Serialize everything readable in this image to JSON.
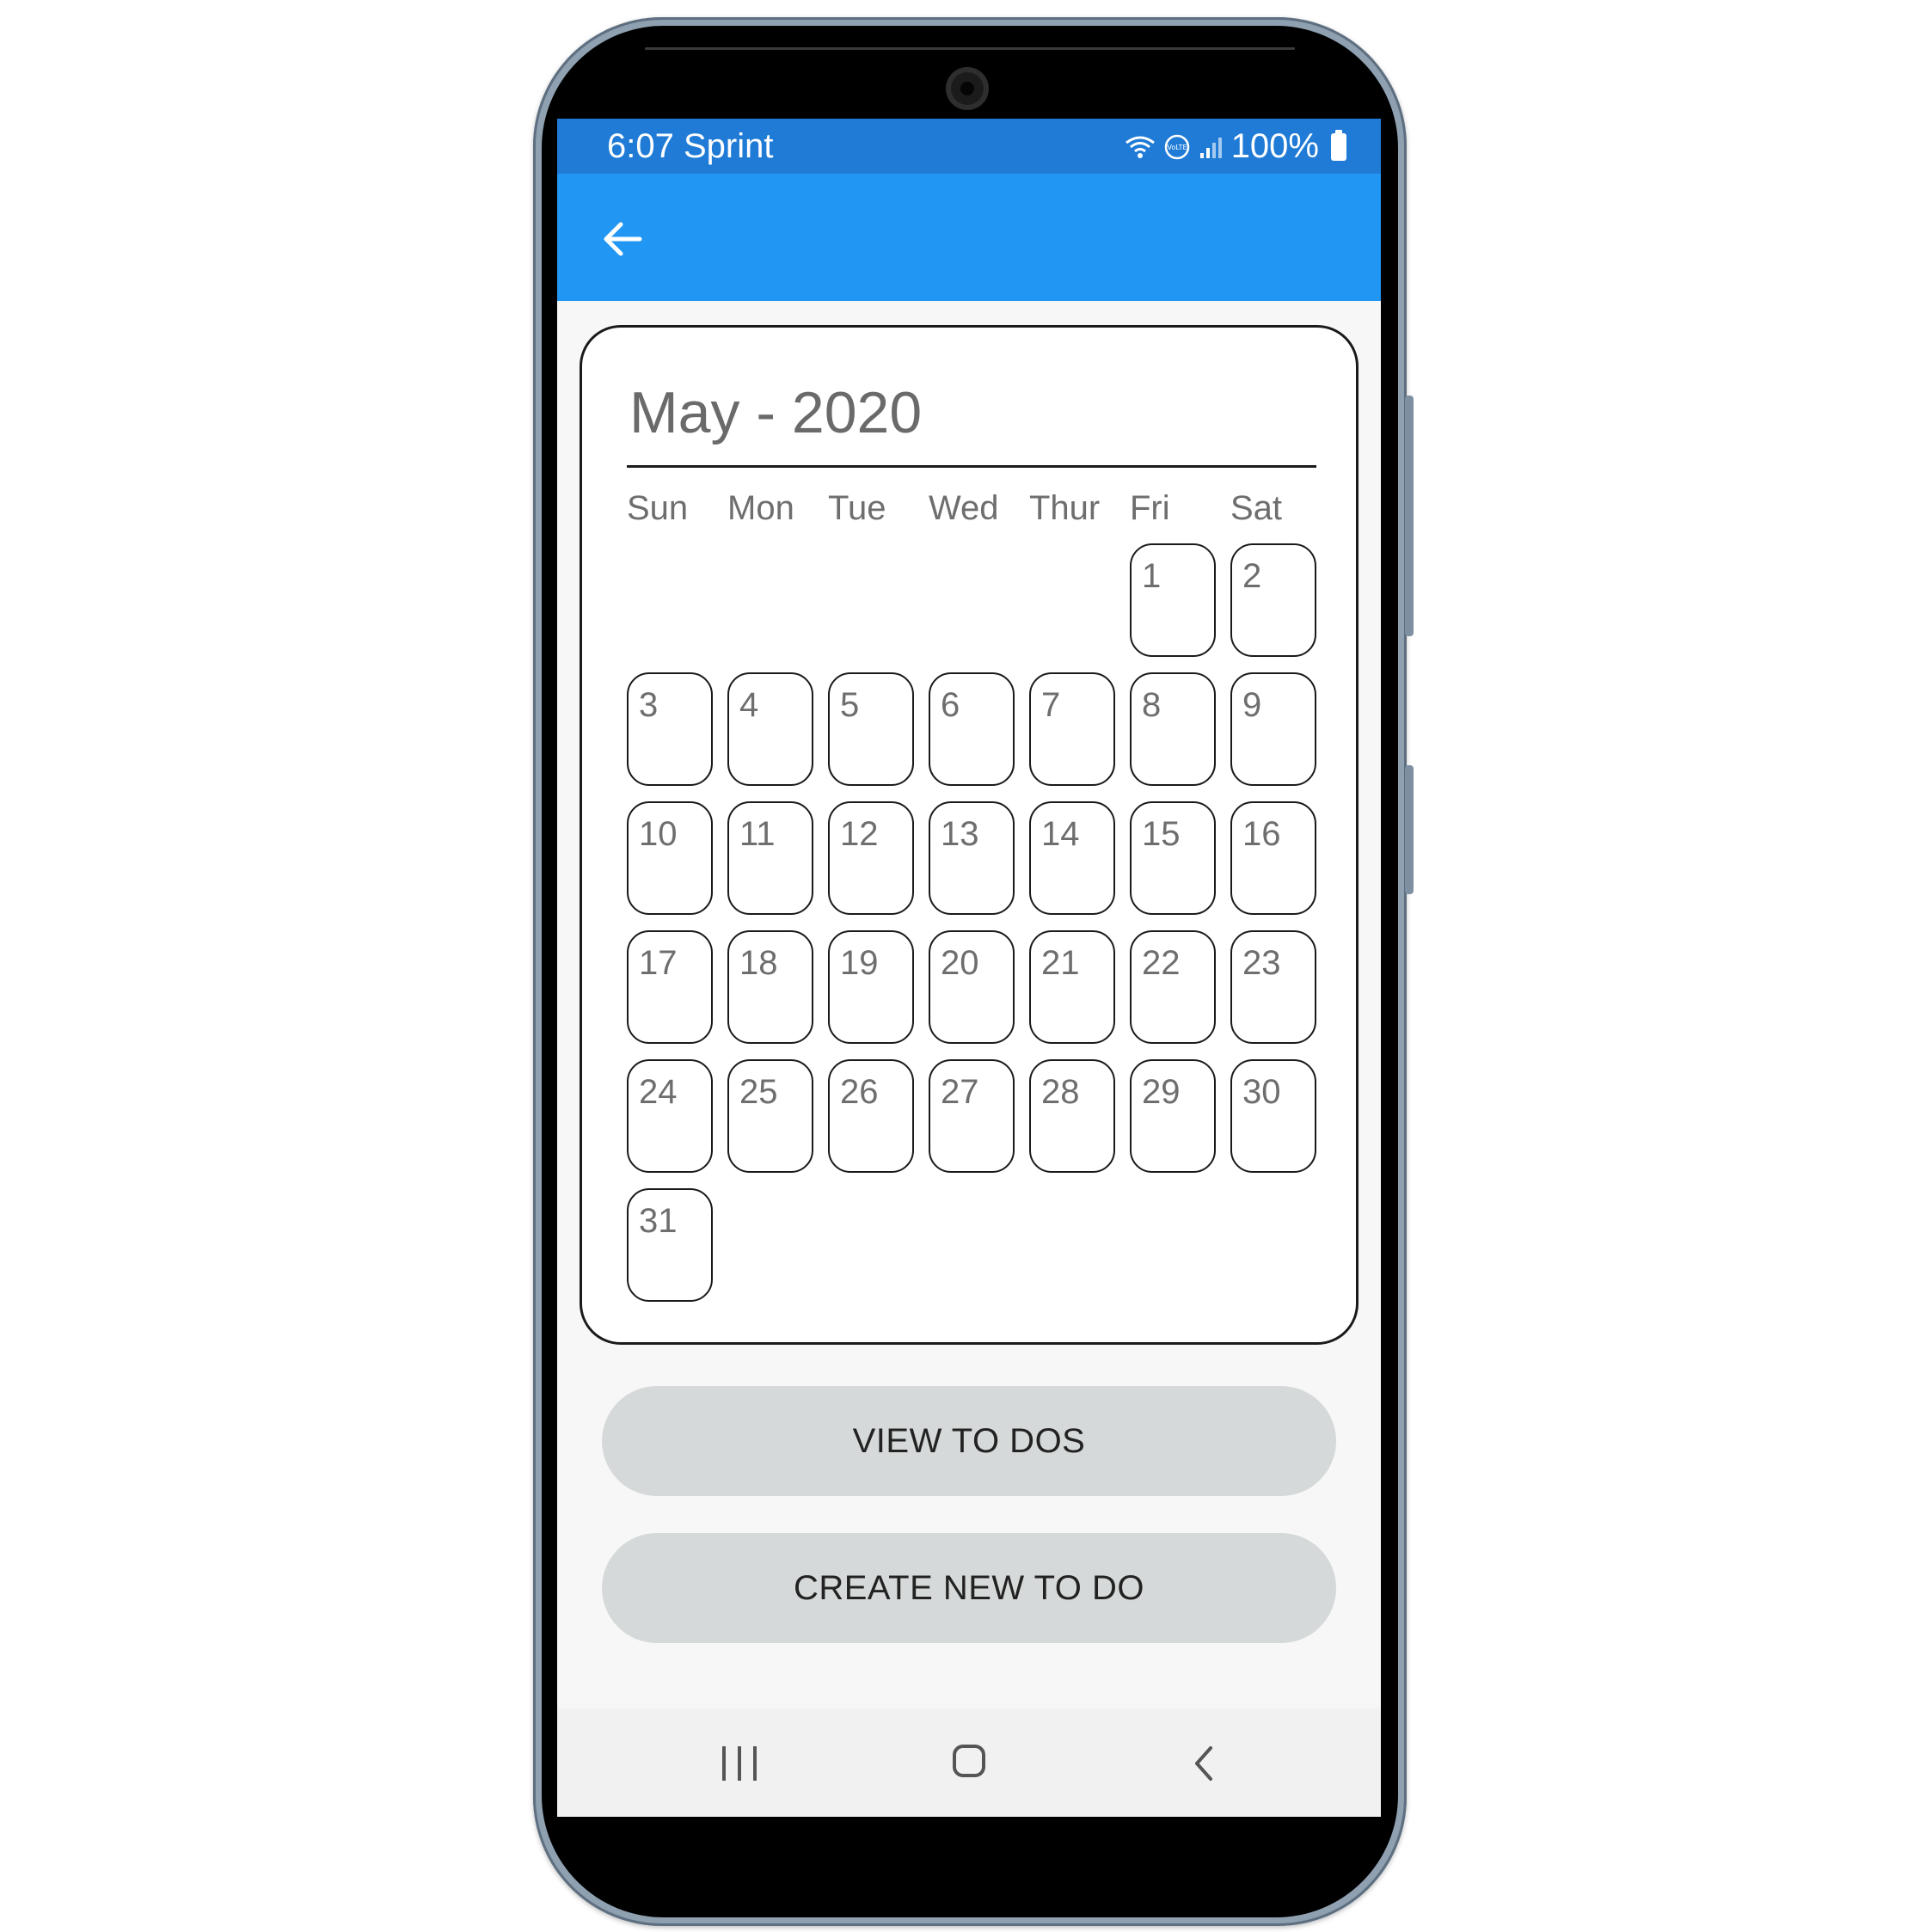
{
  "status_bar": {
    "time_carrier": "6:07 Sprint",
    "battery_percent": "100%",
    "icons": [
      "wifi-icon",
      "volte-icon",
      "signal-icon",
      "battery-icon"
    ]
  },
  "app_bar": {
    "back_icon": "arrow-left-icon"
  },
  "calendar": {
    "title": "May - 2020",
    "weekdays": [
      "Sun",
      "Mon",
      "Tue",
      "Wed",
      "Thur",
      "Fri",
      "Sat"
    ],
    "first_weekday_index": 5,
    "days": [
      "1",
      "2",
      "3",
      "4",
      "5",
      "6",
      "7",
      "8",
      "9",
      "10",
      "11",
      "12",
      "13",
      "14",
      "15",
      "16",
      "17",
      "18",
      "19",
      "20",
      "21",
      "22",
      "23",
      "24",
      "25",
      "26",
      "27",
      "28",
      "29",
      "30",
      "31"
    ]
  },
  "buttons": {
    "view": "VIEW TO DOS",
    "create": "CREATE NEW TO DO"
  },
  "nav_bar": {
    "icons": [
      "recent-apps-icon",
      "home-icon",
      "back-icon"
    ]
  },
  "colors": {
    "status_bar": "#1f7bd6",
    "app_bar": "#2196f3",
    "button_bg": "#d6d9d9"
  }
}
